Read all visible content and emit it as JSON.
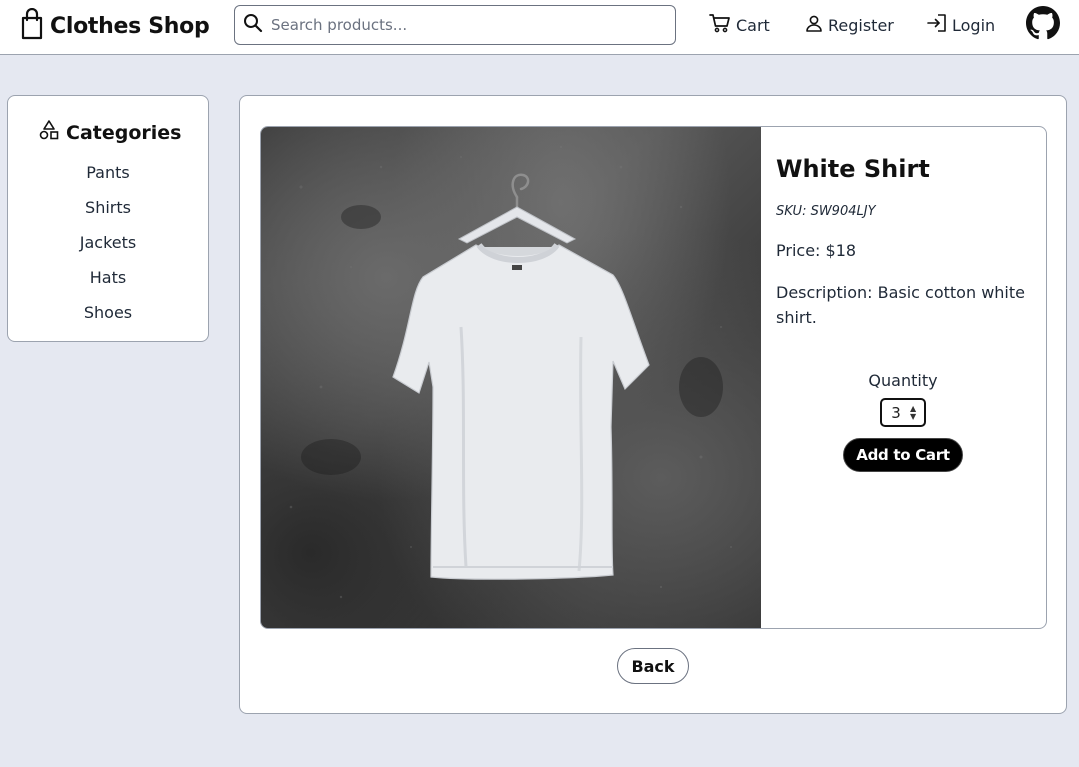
{
  "header": {
    "brand_title": "Clothes Shop",
    "brand_icon": "shopping-bag-icon",
    "search_placeholder": "Search products...",
    "nav": {
      "cart": "Cart",
      "register": "Register",
      "login": "Login"
    },
    "github_icon": "github-icon"
  },
  "sidebar": {
    "title": "Categories",
    "title_icon": "shapes-icon",
    "items": [
      {
        "label": "Pants"
      },
      {
        "label": "Shirts"
      },
      {
        "label": "Jackets"
      },
      {
        "label": "Hats"
      },
      {
        "label": "Shoes"
      }
    ]
  },
  "product": {
    "name": "White Shirt",
    "sku": "SKU: SW904LJY",
    "price": "Price: $18",
    "description": "Description: Basic cotton white shirt.",
    "quantity_label": "Quantity",
    "quantity_value": "3",
    "add_to_cart": "Add to Cart",
    "image": "white-t-shirt-on-hanger-photo"
  },
  "actions": {
    "back": "Back"
  },
  "colors": {
    "page_background": "#e5e8f1",
    "card_background": "#ffffff",
    "border": "#9ca3af",
    "primary_button": "#000000"
  }
}
